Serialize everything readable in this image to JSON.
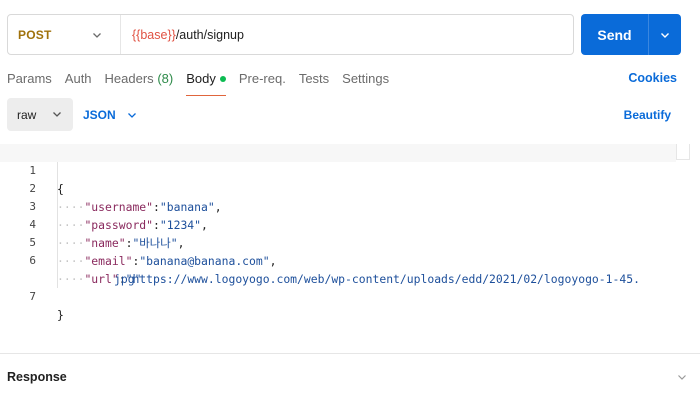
{
  "request": {
    "method": "POST",
    "url_var": "{{base}}",
    "url_path": "/auth/signup",
    "send_label": "Send"
  },
  "tabs": [
    {
      "label": "Params"
    },
    {
      "label": "Auth"
    },
    {
      "label": "Headers",
      "count": "(8)"
    },
    {
      "label": "Body",
      "active": true
    },
    {
      "label": "Pre-req."
    },
    {
      "label": "Tests"
    },
    {
      "label": "Settings"
    }
  ],
  "cookies_label": "Cookies",
  "body": {
    "mode": "raw",
    "language": "JSON",
    "beautify_label": "Beautify"
  },
  "editor": {
    "line_numbers": [
      "1",
      "2",
      "3",
      "4",
      "5",
      "6",
      "7"
    ],
    "lines": {
      "l1": "{",
      "l2_key": "\"username\"",
      "l2_val": "\"banana\"",
      "l3_key": "\"password\"",
      "l3_val": "\"1234\"",
      "l4_key": "\"name\"",
      "l4_val": "\"바나나\"",
      "l5_key": "\"email\"",
      "l5_val": "\"banana@banana.com\"",
      "l6_key": "\"url\"",
      "l6_val_a": "\"https://www.logoyogo.com/web/wp-content/uploads/edd/2021/02/logoyogo-1-45.",
      "l6_val_b": "jpg\"",
      "l7": "}"
    }
  },
  "response_label": "Response",
  "colors": {
    "accent": "#0a6bd9",
    "method": "#a0720c",
    "var": "#e05243",
    "active_dot": "#0cbb52"
  }
}
